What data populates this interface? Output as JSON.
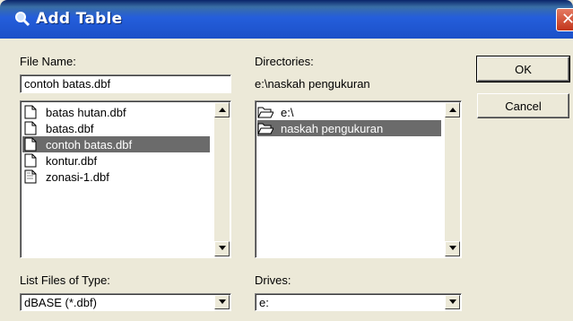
{
  "window": {
    "title": "Add Table",
    "app_icon": "magnifier-icon",
    "close_icon": "close-icon"
  },
  "file_name": {
    "label": "File Name:",
    "value": "contoh batas.dbf"
  },
  "directories": {
    "label": "Directories:",
    "current_path": "e:\\naskah pengukuran",
    "items": [
      {
        "label": "e:\\",
        "icon": "open-folder-icon",
        "selected": false
      },
      {
        "label": "naskah pengukuran",
        "icon": "open-folder-icon",
        "selected": true
      }
    ]
  },
  "files": {
    "items": [
      {
        "label": "batas hutan.dbf",
        "icon": "file-icon",
        "selected": false
      },
      {
        "label": "batas.dbf",
        "icon": "file-icon",
        "selected": false
      },
      {
        "label": "contoh batas.dbf",
        "icon": "file-icon",
        "selected": true
      },
      {
        "label": "kontur.dbf",
        "icon": "file-icon",
        "selected": false
      },
      {
        "label": "zonasi-1.dbf",
        "icon": "file-icon",
        "selected": false
      }
    ]
  },
  "buttons": {
    "ok": "OK",
    "cancel": "Cancel"
  },
  "file_type": {
    "label": "List Files of Type:",
    "value": "dBASE (*.dbf)"
  },
  "drives": {
    "label": "Drives:",
    "value": "e:"
  },
  "colors": {
    "titlebar": "#245edb",
    "dialog_bg": "#ece9d8",
    "selection": "#6b6b6b"
  }
}
